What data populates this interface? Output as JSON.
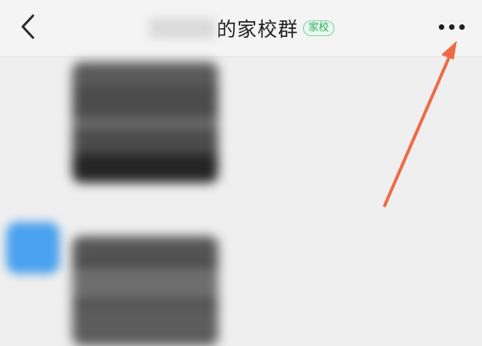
{
  "header": {
    "title": "的家校群",
    "badge": "家校"
  },
  "icons": {
    "back": "chevron-left-icon",
    "more": "more-horizontal-icon"
  },
  "annotation": {
    "arrow_color": "#ef6a45"
  },
  "colors": {
    "badge_green": "#2fb15e",
    "avatar_blue": "#4aa1ee"
  }
}
